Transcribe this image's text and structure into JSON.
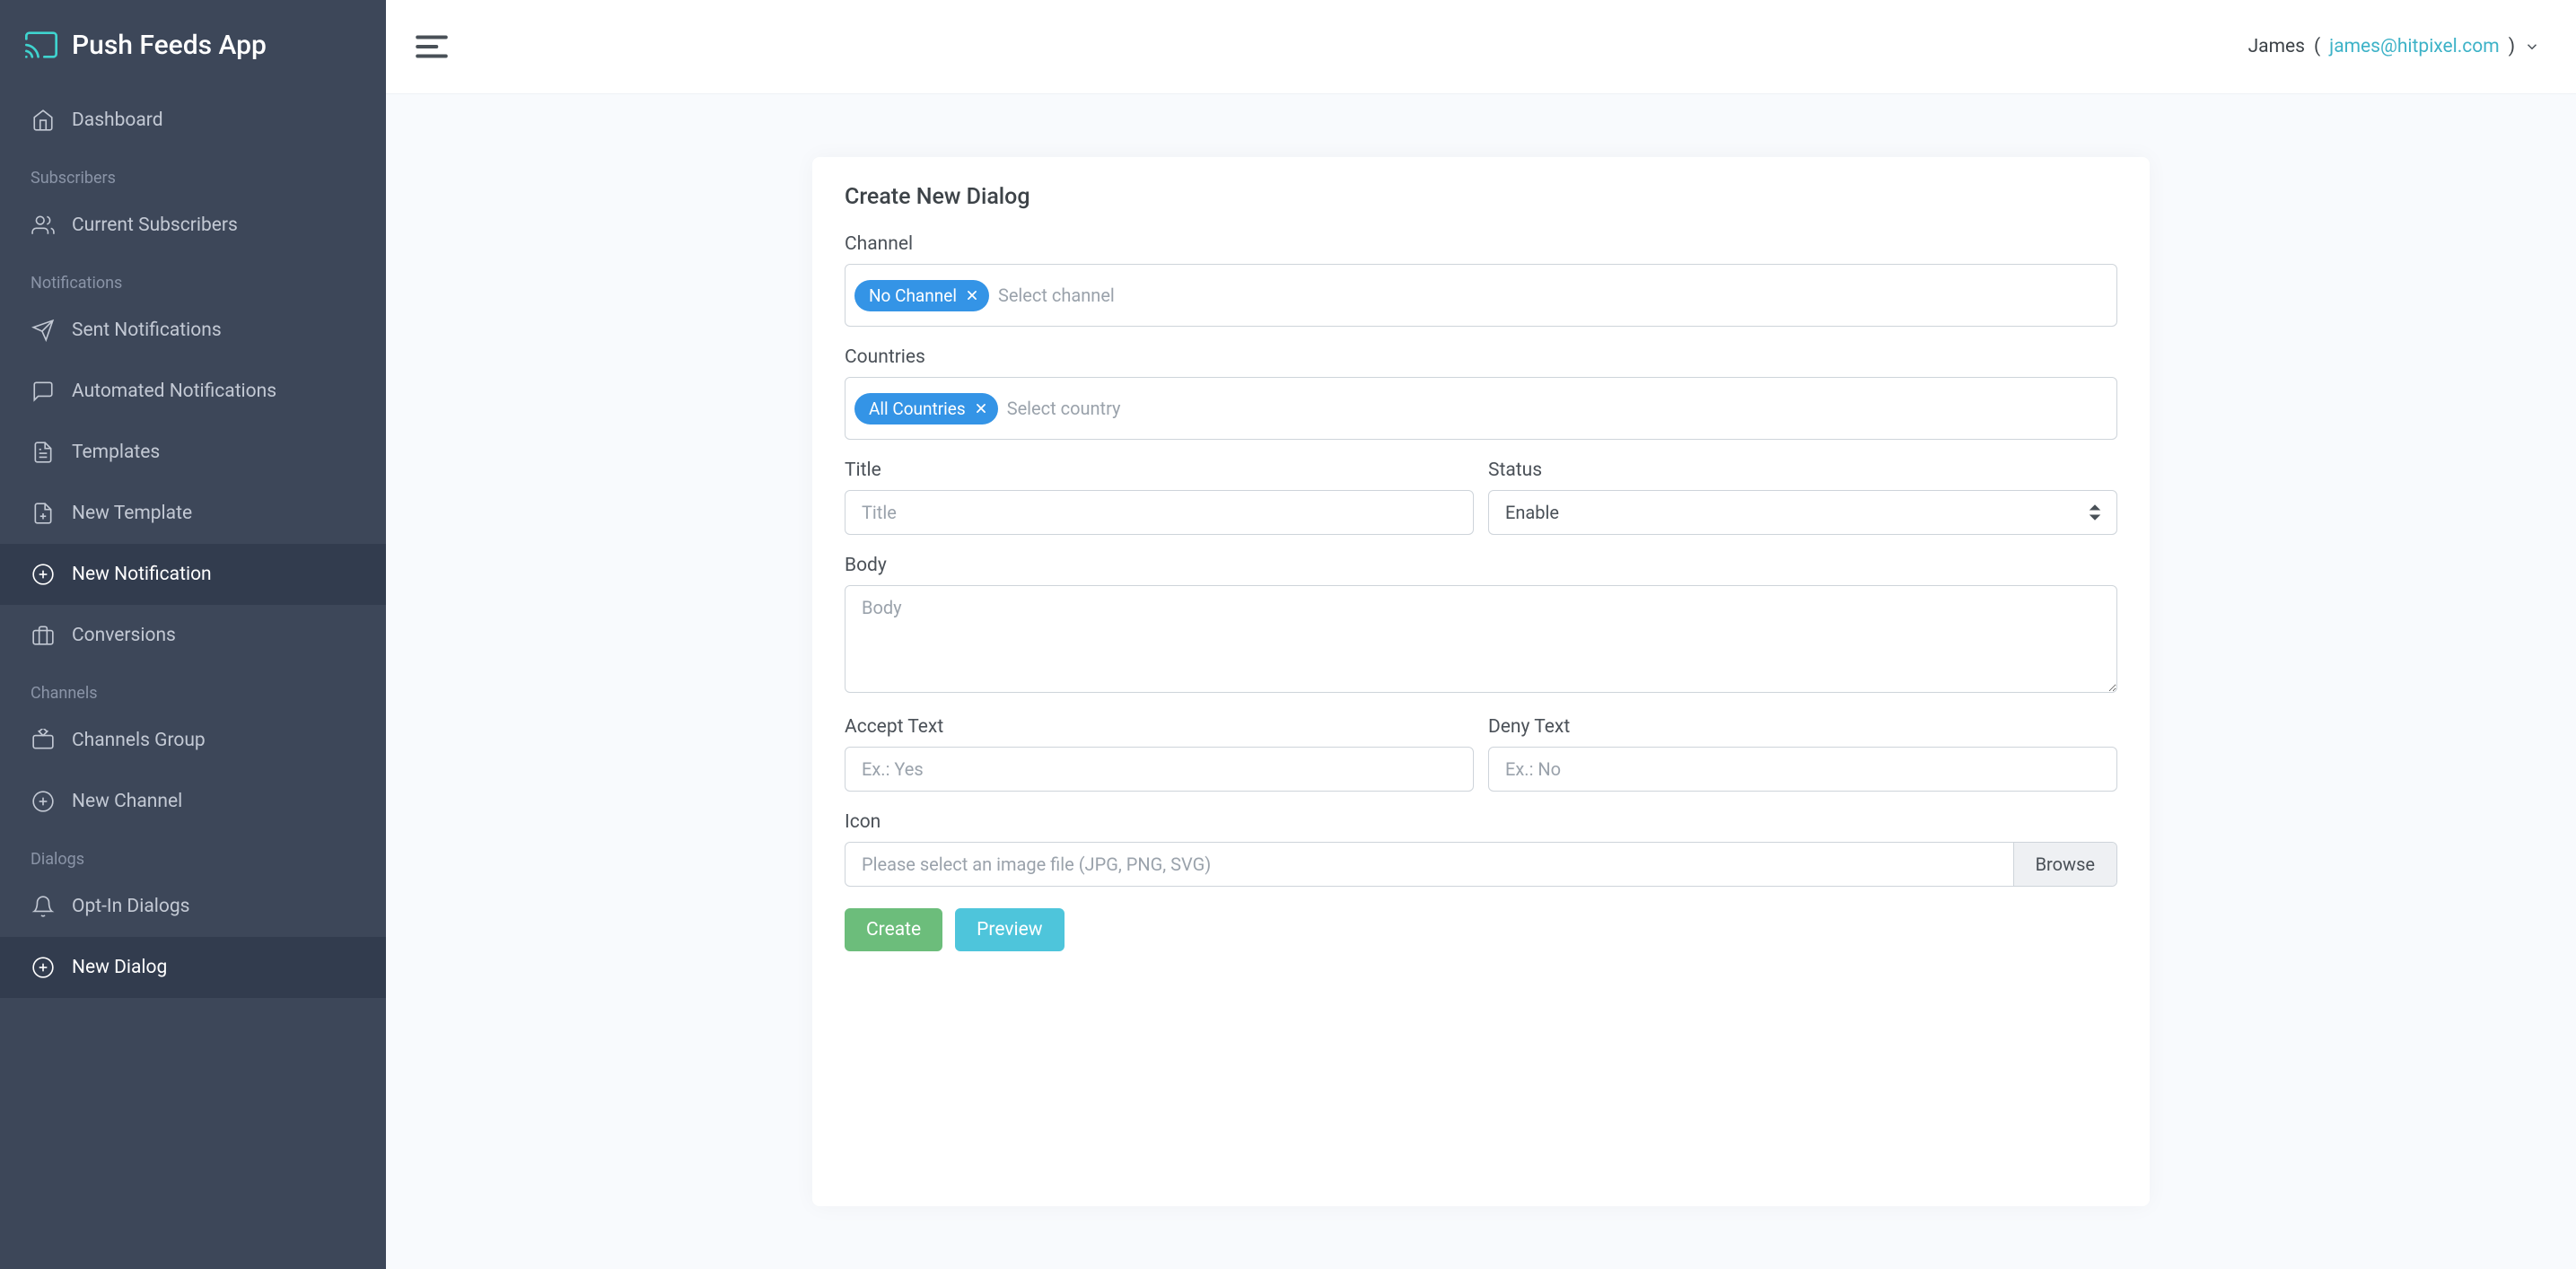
{
  "brand": {
    "name": "Push Feeds App"
  },
  "sidebar": {
    "dashboard": "Dashboard",
    "sections": {
      "subscribers": {
        "header": "Subscribers",
        "current_subscribers": "Current Subscribers"
      },
      "notifications": {
        "header": "Notifications",
        "sent": "Sent Notifications",
        "automated": "Automated Notifications",
        "templates": "Templates",
        "new_template": "New Template",
        "new_notification": "New Notification",
        "conversions": "Conversions"
      },
      "channels": {
        "header": "Channels",
        "channels_group": "Channels Group",
        "new_channel": "New Channel"
      },
      "dialogs": {
        "header": "Dialogs",
        "opt_in": "Opt-In Dialogs",
        "new_dialog": "New Dialog"
      }
    }
  },
  "topbar": {
    "user_name": "James",
    "user_email": "james@hitpixel.com"
  },
  "form": {
    "heading": "Create New Dialog",
    "channel": {
      "label": "Channel",
      "tag": "No Channel",
      "placeholder": "Select channel"
    },
    "countries": {
      "label": "Countries",
      "tag": "All Countries",
      "placeholder": "Select country"
    },
    "title": {
      "label": "Title",
      "placeholder": "Title"
    },
    "status": {
      "label": "Status",
      "value": "Enable"
    },
    "body": {
      "label": "Body",
      "placeholder": "Body"
    },
    "accept": {
      "label": "Accept Text",
      "placeholder": "Ex.: Yes"
    },
    "deny": {
      "label": "Deny Text",
      "placeholder": "Ex.: No"
    },
    "icon": {
      "label": "Icon",
      "placeholder": "Please select an image file (JPG, PNG, SVG)",
      "browse": "Browse"
    },
    "buttons": {
      "create": "Create",
      "preview": "Preview"
    }
  }
}
